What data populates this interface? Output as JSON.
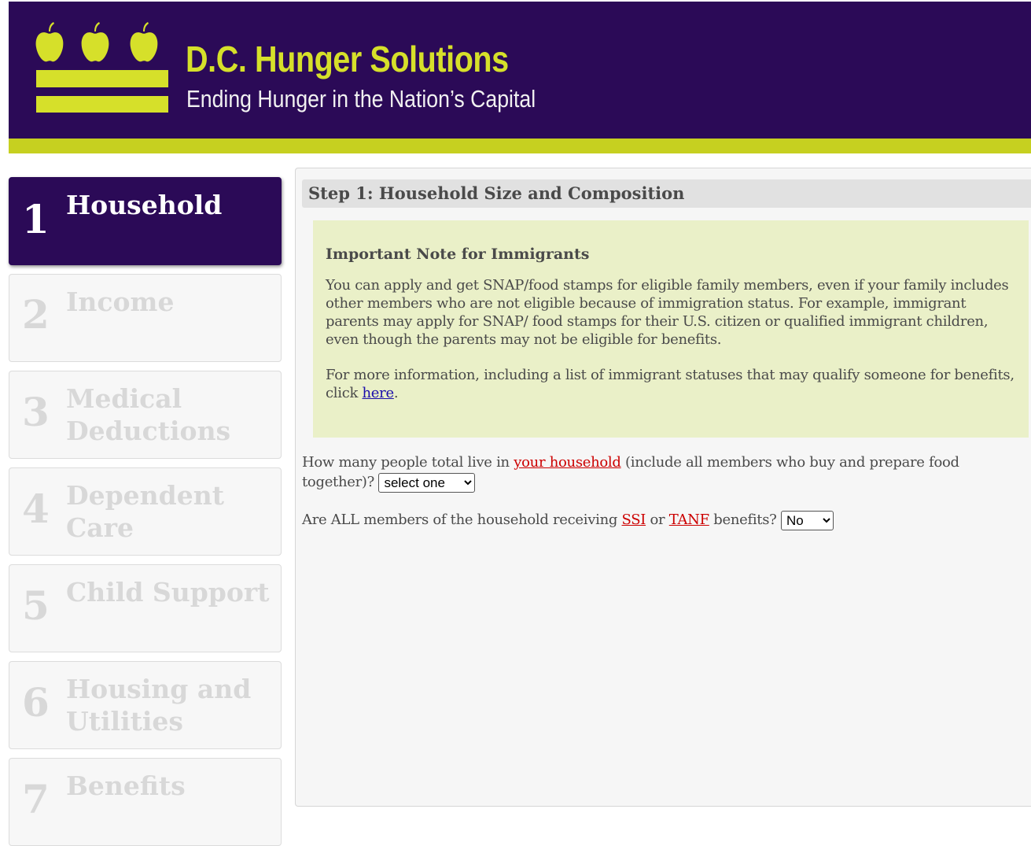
{
  "header": {
    "title": "D.C. Hunger Solutions",
    "tagline": "Ending Hunger in the Nation’s Capital",
    "colors": {
      "background": "#2b0a57",
      "accent": "#c6d020"
    }
  },
  "sidebar": {
    "steps": [
      {
        "number": "1",
        "label": "Household",
        "active": true
      },
      {
        "number": "2",
        "label": "Income"
      },
      {
        "number": "3",
        "label": "Medical Deductions"
      },
      {
        "number": "4",
        "label": "Dependent Care"
      },
      {
        "number": "5",
        "label": "Child Support"
      },
      {
        "number": "6",
        "label": "Housing and Utilities"
      },
      {
        "number": "7",
        "label": "Benefits"
      }
    ]
  },
  "main": {
    "step_heading": "Step 1: Household Size and Composition",
    "note": {
      "title": "Important Note for Immigrants",
      "paragraph1": "You can apply and get SNAP/food stamps for eligible family members, even if your family includes other members who are not eligible because of immigration status. For example, immigrant parents may apply for SNAP/ food stamps for their U.S. citizen or qualified immigrant children, even though the parents may not be eligible for benefits.",
      "paragraph2_prefix": "For more information, including a list of immigrant statuses that may qualify someone for benefits, click ",
      "paragraph2_link": "here",
      "paragraph2_suffix": "."
    },
    "q1": {
      "prefix": "How many people total live in ",
      "link": "your household",
      "suffix": " (include all members who buy and prepare food together)? ",
      "select_value": "select one"
    },
    "q2": {
      "prefix": "Are ALL members of the household receiving ",
      "link1": "SSI",
      "middle": " or ",
      "link2": "TANF",
      "suffix": " benefits? ",
      "select_value": "No"
    }
  }
}
